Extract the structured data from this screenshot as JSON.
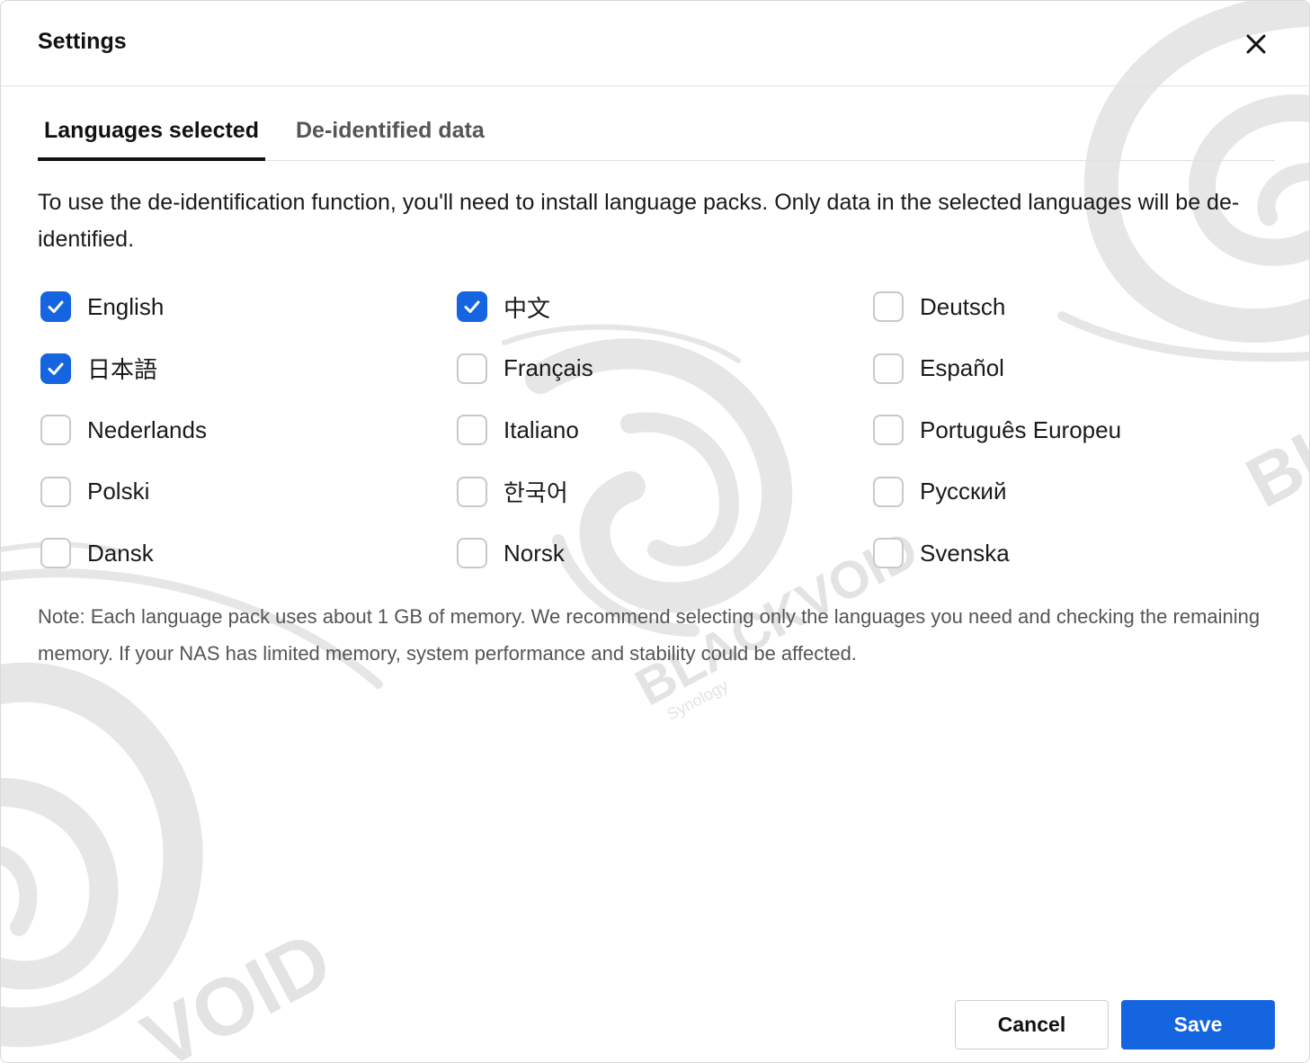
{
  "dialog": {
    "title": "Settings",
    "close_icon": "close-icon"
  },
  "tabs": [
    {
      "label": "Languages selected",
      "active": true
    },
    {
      "label": "De-identified data",
      "active": false
    }
  ],
  "description": "To use the de-identification function, you'll need to install language packs. Only data in the selected languages will be de-identified.",
  "languages": [
    {
      "label": "English",
      "checked": true
    },
    {
      "label": "中文",
      "checked": true
    },
    {
      "label": "Deutsch",
      "checked": false
    },
    {
      "label": "日本語",
      "checked": true
    },
    {
      "label": "Français",
      "checked": false
    },
    {
      "label": "Español",
      "checked": false
    },
    {
      "label": "Nederlands",
      "checked": false
    },
    {
      "label": "Italiano",
      "checked": false
    },
    {
      "label": "Português Europeu",
      "checked": false
    },
    {
      "label": "Polski",
      "checked": false
    },
    {
      "label": "한국어",
      "checked": false
    },
    {
      "label": "Русский",
      "checked": false
    },
    {
      "label": "Dansk",
      "checked": false
    },
    {
      "label": "Norsk",
      "checked": false
    },
    {
      "label": "Svenska",
      "checked": false
    }
  ],
  "note": "Note: Each language pack uses about 1 GB of memory. We recommend selecting only the languages you need and checking the remaining memory. If your NAS has limited memory, system performance and stability could be affected.",
  "footer": {
    "cancel_label": "Cancel",
    "save_label": "Save"
  },
  "colors": {
    "accent": "#1565e0",
    "checkbox_border": "#c9c9c9",
    "text": "#1a1a1a",
    "muted_text": "#555555"
  },
  "watermark": {
    "brand": "BLACKVOID",
    "sub": "Synology"
  }
}
